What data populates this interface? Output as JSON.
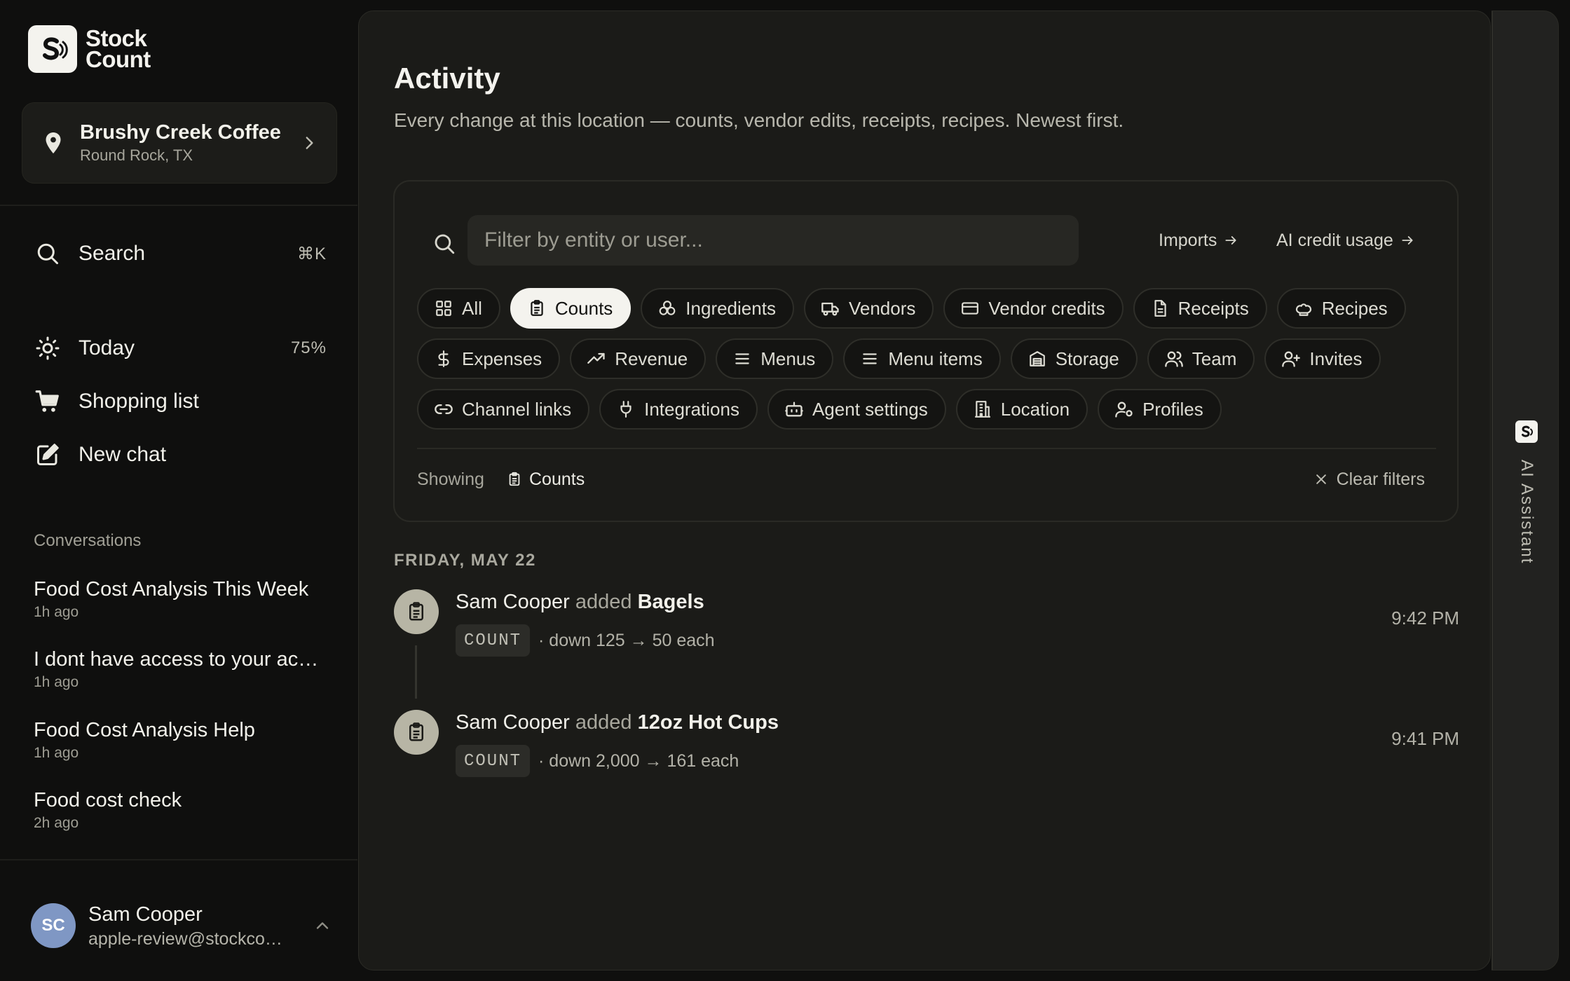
{
  "brand": {
    "line1": "Stock",
    "line2": "Count"
  },
  "location": {
    "name": "Brushy Creek Coffee",
    "subtitle": "Round Rock, TX"
  },
  "nav": {
    "search": {
      "label": "Search",
      "shortcut": "⌘K"
    },
    "today": {
      "label": "Today",
      "value": "75%"
    },
    "shopping": {
      "label": "Shopping list"
    },
    "new_chat": {
      "label": "New chat"
    }
  },
  "conversations": {
    "heading": "Conversations",
    "items": [
      {
        "title": "Food Cost Analysis This Week",
        "time": "1h ago"
      },
      {
        "title": "I dont have access to your account",
        "time": "1h ago"
      },
      {
        "title": "Food Cost Analysis Help",
        "time": "1h ago"
      },
      {
        "title": "Food cost check",
        "time": "2h ago"
      }
    ]
  },
  "user": {
    "initials": "SC",
    "name": "Sam Cooper",
    "email": "apple-review@stockcount.app"
  },
  "main": {
    "title": "Activity",
    "subtitle": "Every change at this location — counts, vendor edits, receipts, recipes. Newest first.",
    "filter_placeholder": "Filter by entity or user...",
    "imports_link": "Imports",
    "ai_credit_link": "AI credit usage",
    "chips": {
      "all": "All",
      "counts": "Counts",
      "ingredients": "Ingredients",
      "vendors": "Vendors",
      "vendor_credits": "Vendor credits",
      "receipts": "Receipts",
      "recipes": "Recipes",
      "expenses": "Expenses",
      "revenue": "Revenue",
      "menus": "Menus",
      "menu_items": "Menu items",
      "storage": "Storage",
      "team": "Team",
      "invites": "Invites",
      "channel_links": "Channel links",
      "integrations": "Integrations",
      "agent_settings": "Agent settings",
      "location": "Location",
      "profiles": "Profiles"
    },
    "active_chip": "Counts",
    "showing_label": "Showing",
    "showing_value": "Counts",
    "clear_filters": "Clear filters",
    "date_heading": "FRIDAY, MAY 22",
    "activities": [
      {
        "user": "Sam Cooper",
        "verb": "added",
        "entity": "Bagels",
        "badge": "COUNT",
        "detail": "· down 125 → 50 each",
        "time": "9:42 PM"
      },
      {
        "user": "Sam Cooper",
        "verb": "added",
        "entity": "12oz Hot Cups",
        "badge": "COUNT",
        "detail": "· down 2,000 → 161 each",
        "time": "9:41 PM"
      }
    ]
  },
  "ai_rail": {
    "label": "AI Assistant"
  },
  "colors": {
    "accent_active_chip": "#f4f3ee",
    "avatar": "#7f97c4",
    "activity_icon": "#b7b5a5",
    "panel": "#1b1b18"
  }
}
